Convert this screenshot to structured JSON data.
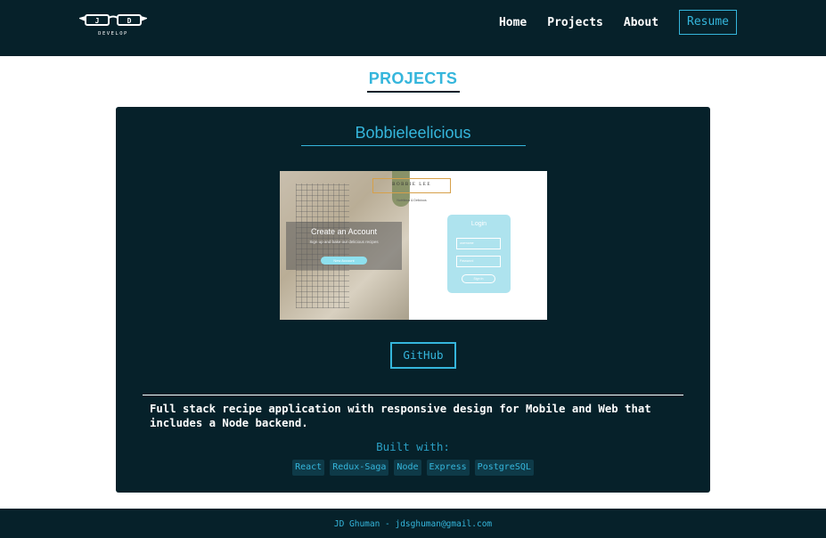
{
  "header": {
    "logo": {
      "initials": [
        "J",
        "D"
      ],
      "subtitle": "DEVELOP"
    },
    "nav": [
      "Home",
      "Projects",
      "About"
    ],
    "resume_label": "Resume"
  },
  "page": {
    "section_title": "PROJECTS"
  },
  "project": {
    "name": "Bobbieleelicious",
    "screenshot": {
      "brand": "BOBBIE LEE",
      "tagline": "Nutritious & Delicious",
      "create_account": "Create an Account",
      "create_sub": "Sign up and bake our delicious recipes",
      "new_account_button": "New Account",
      "login_title": "Login",
      "username_placeholder": "username",
      "password_placeholder": "Password",
      "signin_button": "Sign In"
    },
    "github_label": "GitHub",
    "description": "Full stack recipe application with responsive design for Mobile and Web that includes a Node backend.",
    "built_with_label": "Built with:",
    "technologies": [
      "React",
      "Redux-Saga",
      "Node",
      "Express",
      "PostgreSQL"
    ]
  },
  "footer": {
    "text": "JD Ghuman - jdsghuman@gmail.com"
  },
  "colors": {
    "navy": "#06212a",
    "accent": "#35b6dc",
    "white": "#ffffff"
  },
  "icons": {
    "logo": "glasses-logo-icon"
  }
}
